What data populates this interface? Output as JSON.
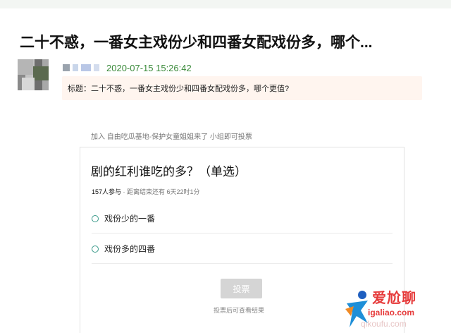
{
  "post": {
    "title": "二十不惑，一番女主戏份少和四番女配戏份多，哪个...",
    "timestamp": "2020-07-15 15:26:42",
    "subject": "标题：二十不惑，一番女主戏份少和四番女配戏份多，哪个更值?"
  },
  "group": {
    "join_text": "加入 自由吃瓜基地-保护女童姐姐来了 小组即可投票"
  },
  "poll": {
    "question": "剧的红利谁吃的多？（单选）",
    "participants": "157人参与",
    "time_left": " · 距离结束还有 6天22时1分",
    "options": [
      {
        "label": "戏份少的一番"
      },
      {
        "label": "戏份多的四番"
      }
    ],
    "vote_button": "投票",
    "vote_hint": "投票后可查看结果"
  },
  "watermark": {
    "text": "爱尬聊",
    "url": "igaliao.com",
    "url2": "qikoufu.com"
  },
  "colors": {
    "timestamp": "#3a8a3a",
    "subject_bg": "#fff5ef",
    "radio": "#3a9a8a",
    "vote_button_bg": "#d5d5d5",
    "watermark": "#e63a3a"
  },
  "icons": {
    "radio": "radio-circle-icon",
    "avatar": "pixelated-avatar",
    "watermark_logo": "watermark-logo-icon"
  }
}
